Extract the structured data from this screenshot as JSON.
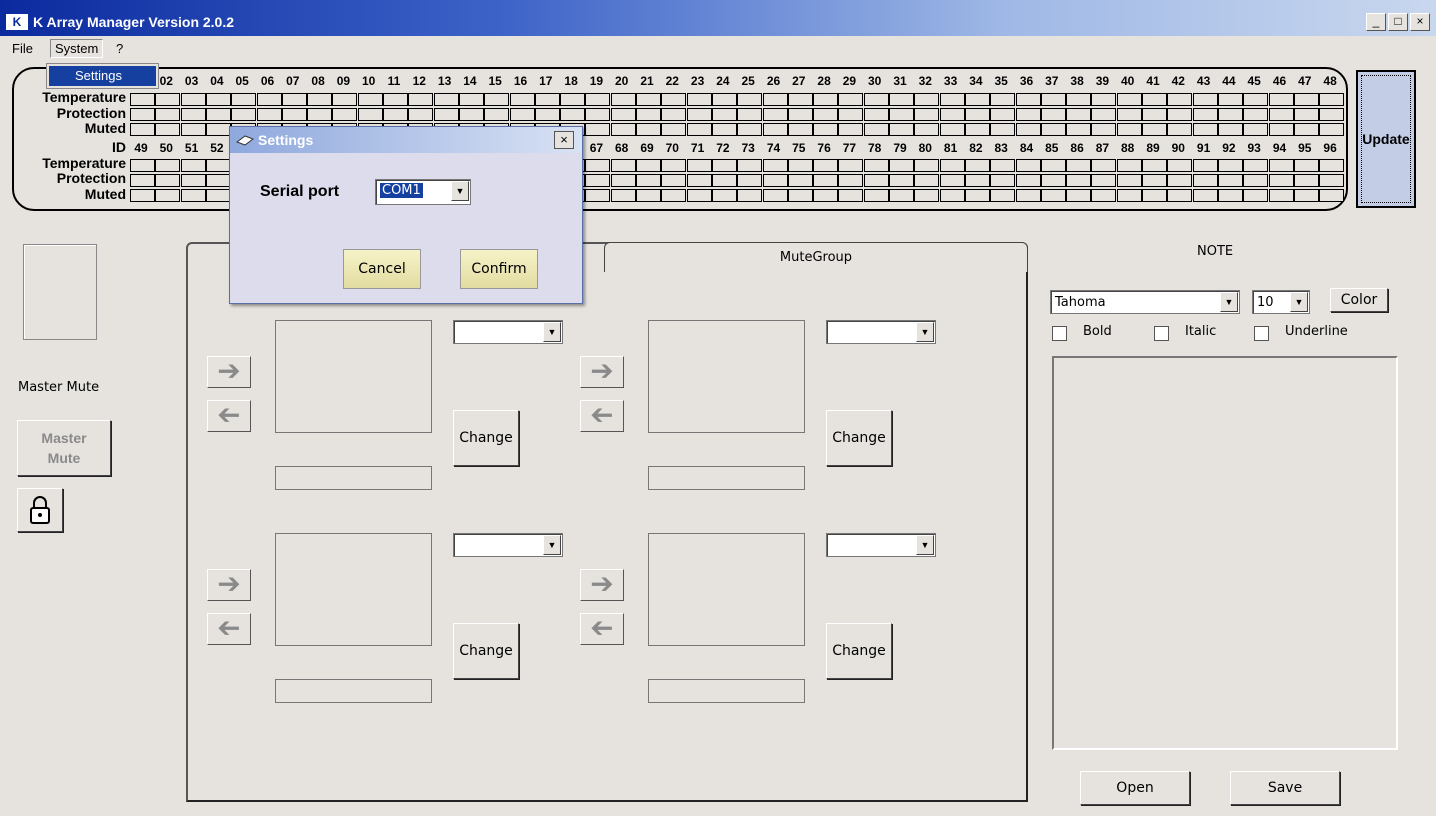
{
  "window": {
    "title": "K Array Manager Version 2.0.2",
    "logo": "K",
    "min": "_",
    "max": "□",
    "close": "×"
  },
  "menu": {
    "file": "File",
    "system": "System",
    "help": "?",
    "dropdown_item": "Settings"
  },
  "status": {
    "row_labels_top": [
      "Temperature",
      "Protection",
      "Muted"
    ],
    "row_labels_bottom": [
      "ID",
      "Temperature",
      "Protection",
      "Muted"
    ],
    "ids_top": [
      "02",
      "03",
      "04",
      "05",
      "06",
      "07",
      "08",
      "09",
      "10",
      "11",
      "12",
      "13",
      "14",
      "15",
      "16",
      "17",
      "18",
      "19",
      "20",
      "21",
      "22",
      "23",
      "24",
      "25",
      "26",
      "27",
      "28",
      "29",
      "30",
      "31",
      "32",
      "33",
      "34",
      "35",
      "36",
      "37",
      "38",
      "39",
      "40",
      "41",
      "42",
      "43",
      "44",
      "45",
      "46",
      "47",
      "48"
    ],
    "ids_bottom_left": [
      "49",
      "50",
      "51",
      "52"
    ],
    "ids_bottom_right": [
      "67",
      "68",
      "69",
      "70",
      "71",
      "72",
      "73",
      "74",
      "75",
      "76",
      "77",
      "78",
      "79",
      "80",
      "81",
      "82",
      "83",
      "84",
      "85",
      "86",
      "87",
      "88",
      "89",
      "90",
      "91",
      "92",
      "93",
      "94",
      "95",
      "96"
    ]
  },
  "update_button": "Update",
  "left": {
    "master_mute_label": "Master Mute",
    "master_mute_button": "Master\nMute",
    "lock_icon": "lock-icon"
  },
  "tabs": {
    "mutegroup": "MuteGroup"
  },
  "groups": {
    "change_label": "Change"
  },
  "note": {
    "title": "NOTE",
    "font": "Tahoma",
    "size": "10",
    "color_button": "Color",
    "bold": "Bold",
    "italic": "Italic",
    "underline": "Underline",
    "open": "Open",
    "save": "Save"
  },
  "dialog": {
    "title": "Settings",
    "serial_label": "Serial port",
    "serial_value": "COM1",
    "cancel": "Cancel",
    "confirm": "Confirm",
    "close": "×"
  }
}
